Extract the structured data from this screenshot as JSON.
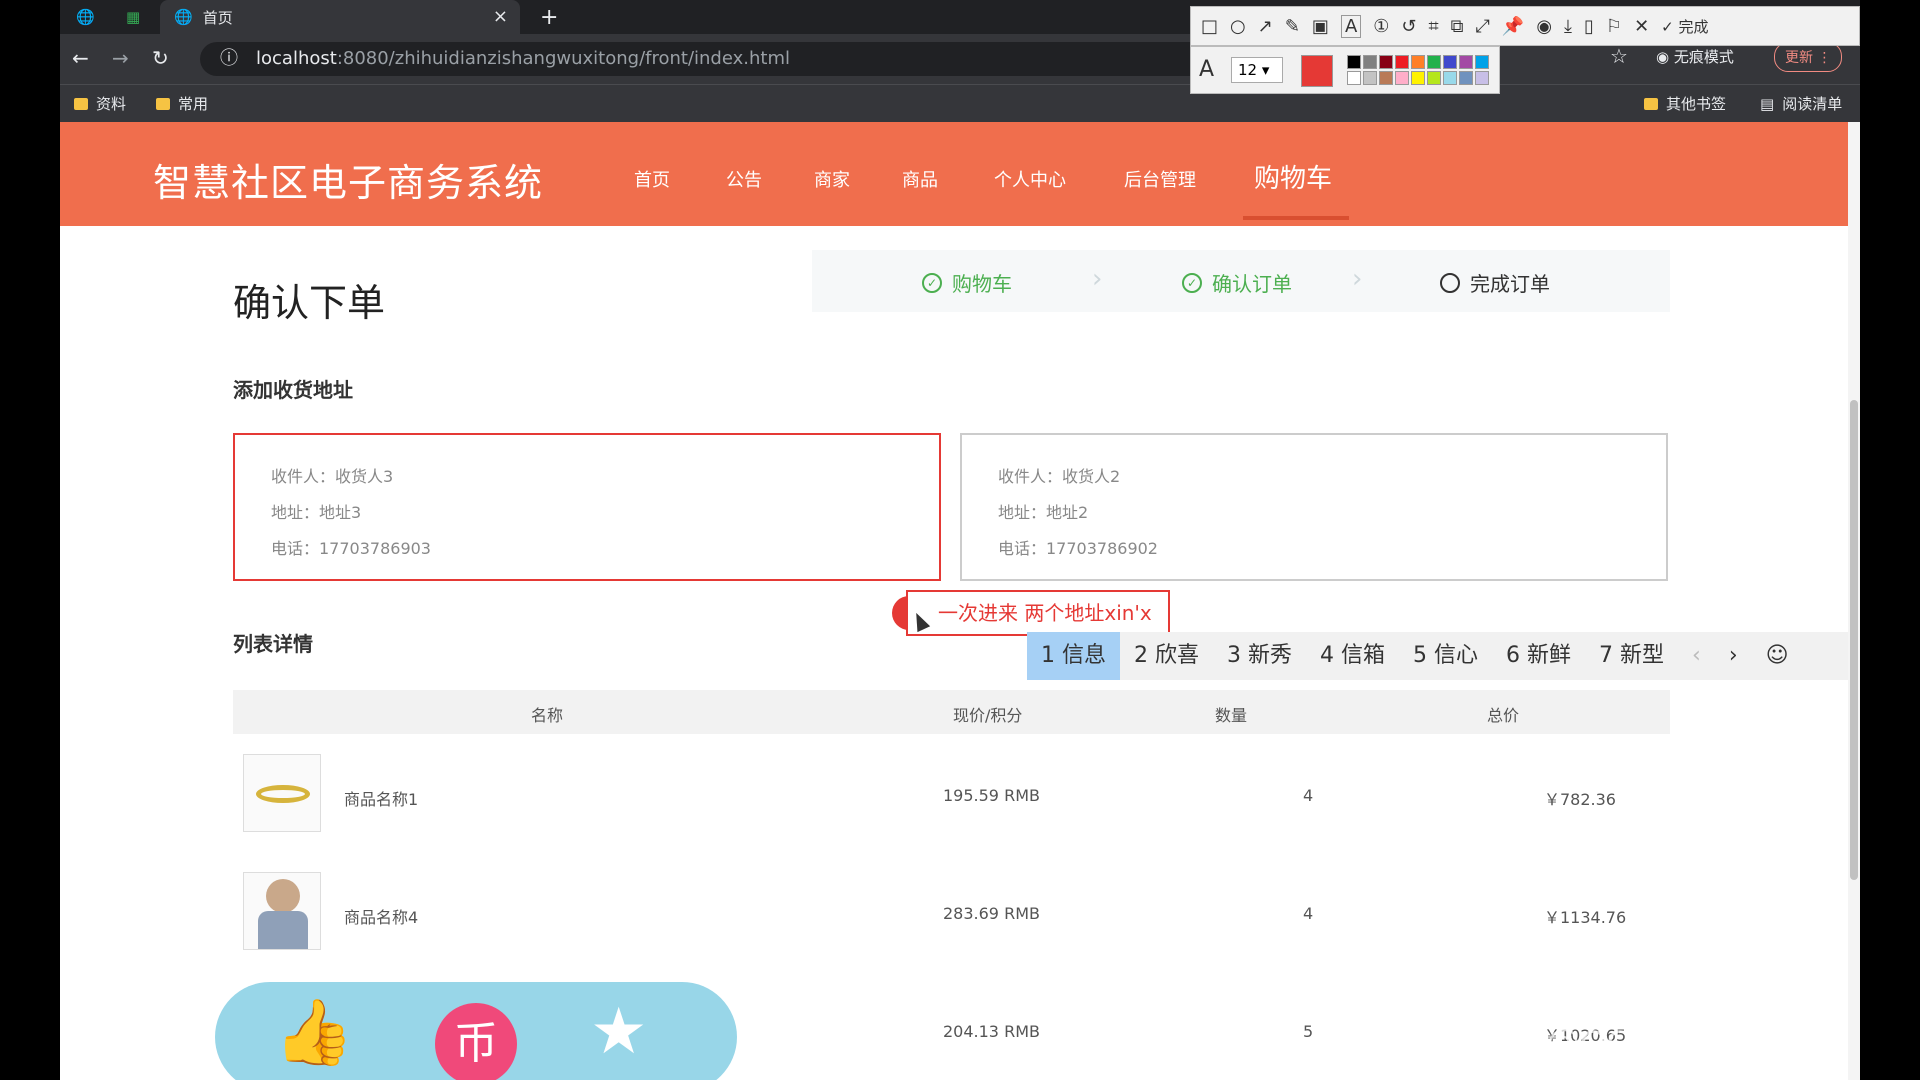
{
  "browser": {
    "tab_title": "首页",
    "tab_close": "×",
    "new_tab": "+",
    "url_host": "localhost",
    "url_rest": ":8080/zhihuidianzishangwuxitong/front/index.html",
    "bookmarks": [
      "资料",
      "常用"
    ],
    "right_bookmarks": [
      "其他书签",
      "阅读清单"
    ],
    "incognito": "无痕模式",
    "update": "更新"
  },
  "capture_toolbar": {
    "done": "完成",
    "font_size": "12",
    "palette": [
      "#000000",
      "#7f7f7f",
      "#880015",
      "#ed1c24",
      "#ff7f27",
      "#22b14c",
      "#3f48cc",
      "#a349a4",
      "#00a2e8",
      "#ffffff",
      "#c3c3c3",
      "#b97a57",
      "#ffaec9",
      "#fff200",
      "#b5e61d",
      "#99d9ea",
      "#7092be",
      "#c8bfe7"
    ],
    "active_color": "#e53935"
  },
  "site": {
    "logo": "智慧社区电子商务系统",
    "menu": [
      "首页",
      "公告",
      "商家",
      "商品",
      "个人中心",
      "后台管理",
      "购物车"
    ],
    "active_menu": "购物车",
    "accent": "#f06e4d"
  },
  "page": {
    "title": "确认下单",
    "steps": [
      "购物车",
      "确认订单",
      "完成订单"
    ],
    "address_section": "添加收货地址",
    "addresses": [
      {
        "recipient": "收件人：收货人3",
        "address": "地址：地址3",
        "phone": "电话：17703786903"
      },
      {
        "recipient": "收件人：收货人2",
        "address": "地址：地址2",
        "phone": "电话：17703786902"
      }
    ],
    "list_section": "列表详情"
  },
  "ime": {
    "input": "一次进来 两个地址xin'x",
    "candidates": [
      "1 信息",
      "2 欣喜",
      "3 新秀",
      "4 信箱",
      "5 信心",
      "6 新鲜",
      "7 新型"
    ],
    "prev": "‹",
    "next": "›",
    "emoji": "☺"
  },
  "table": {
    "headers": [
      "名称",
      "现价/积分",
      "数量",
      "总价"
    ],
    "rows": [
      {
        "name": "商品名称1",
        "price": "195.59 RMB",
        "qty": "4",
        "total": "￥782.36"
      },
      {
        "name": "商品名称4",
        "price": "283.69 RMB",
        "qty": "4",
        "total": "￥1134.76"
      },
      {
        "name": "",
        "price": "204.13 RMB",
        "qty": "5",
        "total": "￥1020.65"
      }
    ]
  },
  "overlay": {
    "watermark": "CSDN @QQ3295391197",
    "icons": [
      "👍",
      "币",
      "★"
    ]
  }
}
